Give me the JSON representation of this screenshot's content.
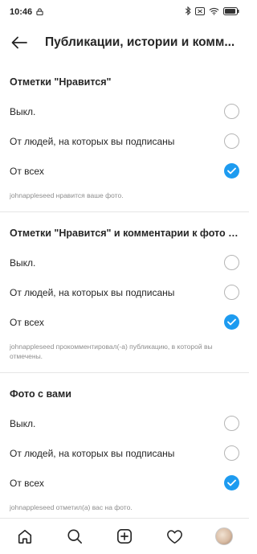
{
  "status_bar": {
    "time": "10:46",
    "icons": [
      "lock-icon",
      "bluetooth-icon",
      "sim-off-icon",
      "wifi-icon",
      "battery-icon"
    ]
  },
  "header": {
    "title": "Публикации, истории и комм...",
    "back_icon": "arrow-left-icon"
  },
  "sections": [
    {
      "title": "Отметки \"Нравится\"",
      "options": [
        "Выкл.",
        "От людей, на которых вы подписаны",
        "От всех"
      ],
      "selected": "От всех",
      "note": "johnappleseed нравится ваше фото."
    },
    {
      "title": "Отметки \"Нравится\" и комментарии к фото с...",
      "options": [
        "Выкл.",
        "От людей, на которых вы подписаны",
        "От всех"
      ],
      "selected": "От всех",
      "note": "johnappleseed прокомментировал(-а) публикацию, в которой вы отмечены."
    },
    {
      "title": "Фото с вами",
      "options": [
        "Выкл.",
        "От людей, на которых вы подписаны",
        "От всех"
      ],
      "selected": "От всех",
      "note": "johnappleseed отметил(а) вас на фото."
    }
  ],
  "bottom_nav": {
    "items": [
      "home-icon",
      "search-icon",
      "add-post-icon",
      "activity-heart-icon",
      "profile-avatar"
    ]
  },
  "colors": {
    "accent": "#1d9bf0",
    "text": "#262626",
    "muted": "#8e8e8e",
    "divider": "#e6e6e6"
  }
}
